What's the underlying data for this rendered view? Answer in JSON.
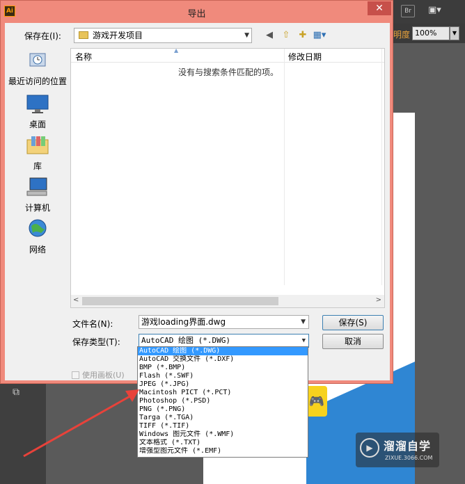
{
  "background_app": {
    "br_button": "Br",
    "opacity_label": "明度",
    "zoom_value": "100%"
  },
  "dialog": {
    "title": "导出",
    "app_logo": "Ai",
    "close_glyph": "✕",
    "save_in_label": "保存在(I):",
    "save_in_value": "游戏开发项目",
    "places": [
      {
        "label": "最近访问的位置",
        "icon": "recent-places-icon"
      },
      {
        "label": "桌面",
        "icon": "desktop-icon"
      },
      {
        "label": "库",
        "icon": "libraries-icon"
      },
      {
        "label": "计算机",
        "icon": "computer-icon"
      },
      {
        "label": "网络",
        "icon": "network-icon"
      }
    ],
    "columns": {
      "name": "名称",
      "date": "修改日期"
    },
    "empty_message": "没有与搜索条件匹配的项。",
    "filename_label": "文件名(N):",
    "filename_value": "游戏loading界面.dwg",
    "filetype_label": "保存类型(T):",
    "filetype_value": "AutoCAD 绘图 (*.DWG)",
    "save_button": "保存(S)",
    "cancel_button": "取消",
    "use_artboards_label": "使用画板(U)",
    "filetype_options": [
      "AutoCAD 绘图 (*.DWG)",
      "AutoCAD 交换文件 (*.DXF)",
      "BMP (*.BMP)",
      "Flash (*.SWF)",
      "JPEG (*.JPG)",
      "Macintosh PICT (*.PCT)",
      "Photoshop (*.PSD)",
      "PNG (*.PNG)",
      "Targa (*.TGA)",
      "TIFF (*.TIF)",
      "Windows 图元文件 (*.WMF)",
      "文本格式 (*.TXT)",
      "增强型图元文件 (*.EMF)"
    ],
    "selected_option_index": 0
  },
  "watermark": {
    "title": "溜溜自学",
    "url": "ZIXUE.3066.COM"
  },
  "colors": {
    "dialog_frame": "#f08a7c",
    "selection": "#3399ff",
    "annotation_arrow": "#e8423a"
  }
}
